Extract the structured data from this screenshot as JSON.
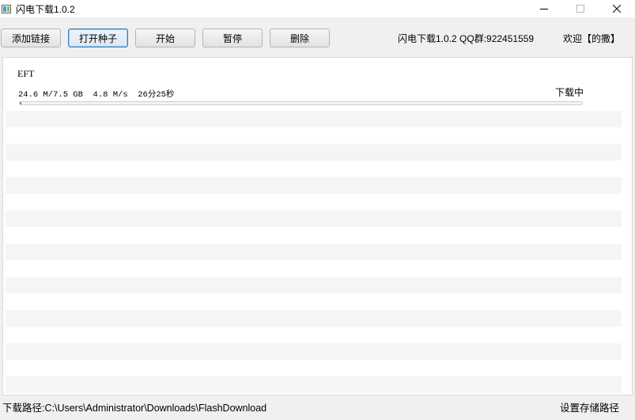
{
  "window": {
    "title": "闪电下载1.0.2",
    "app_icon": "app-icon",
    "controls": [
      "minimize-icon",
      "maximize-icon",
      "close-icon"
    ]
  },
  "toolbar": {
    "buttons": [
      {
        "label": "添加链接"
      },
      {
        "label": "打开种子"
      },
      {
        "label": "开始"
      },
      {
        "label": "暂停"
      },
      {
        "label": "删除"
      }
    ],
    "app_info": "闪电下载1.0.2  QQ群:922451559",
    "welcome": "欢迎【的撒】"
  },
  "downloads": [
    {
      "name": "EFT",
      "stats": "24.6 M/7.5 GB  4.8 M/s  26分25秒",
      "status": "下载中",
      "progress": 0.003
    }
  ],
  "statusbar": {
    "path_label": "下载路径:C:\\Users\\Administrator\\Downloads\\FlashDownload",
    "set_path": "设置存储路径"
  },
  "colors": {
    "accent": "#3c7fb1",
    "progress": "#3d8ee0",
    "stripe": "#f5f5f5"
  }
}
